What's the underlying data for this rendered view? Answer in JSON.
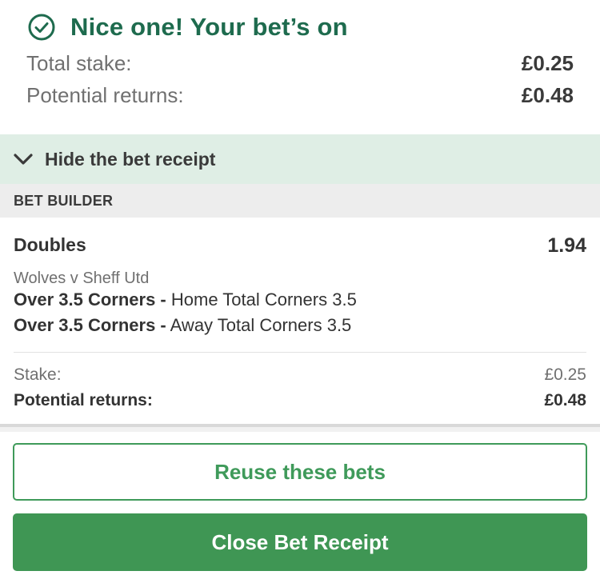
{
  "header": {
    "title": "Nice one! Your bet’s on",
    "total_stake_label": "Total stake:",
    "total_stake_value": "£0.25",
    "potential_returns_label": "Potential returns:",
    "potential_returns_value": "£0.48"
  },
  "receipt_toggle": {
    "label": "Hide the bet receipt"
  },
  "section": {
    "title": "BET BUILDER"
  },
  "bet": {
    "type": "Doubles",
    "odds": "1.94",
    "event": "Wolves v Sheff Utd",
    "selections": [
      {
        "name": "Over 3.5 Corners -",
        "market": "Home Total Corners 3.5"
      },
      {
        "name": "Over 3.5 Corners -",
        "market": "Away Total Corners 3.5"
      }
    ],
    "stake_label": "Stake:",
    "stake_value": "£0.25",
    "returns_label": "Potential returns:",
    "returns_value": "£0.48"
  },
  "buttons": {
    "reuse": "Reuse these bets",
    "close": "Close Bet Receipt"
  },
  "icons": {
    "success": "check-circle-icon",
    "toggle": "chevron-down-icon"
  },
  "colors": {
    "brand_green": "#1e6b4e",
    "button_green": "#3f9654",
    "toggle_bg": "#dfeee5"
  }
}
